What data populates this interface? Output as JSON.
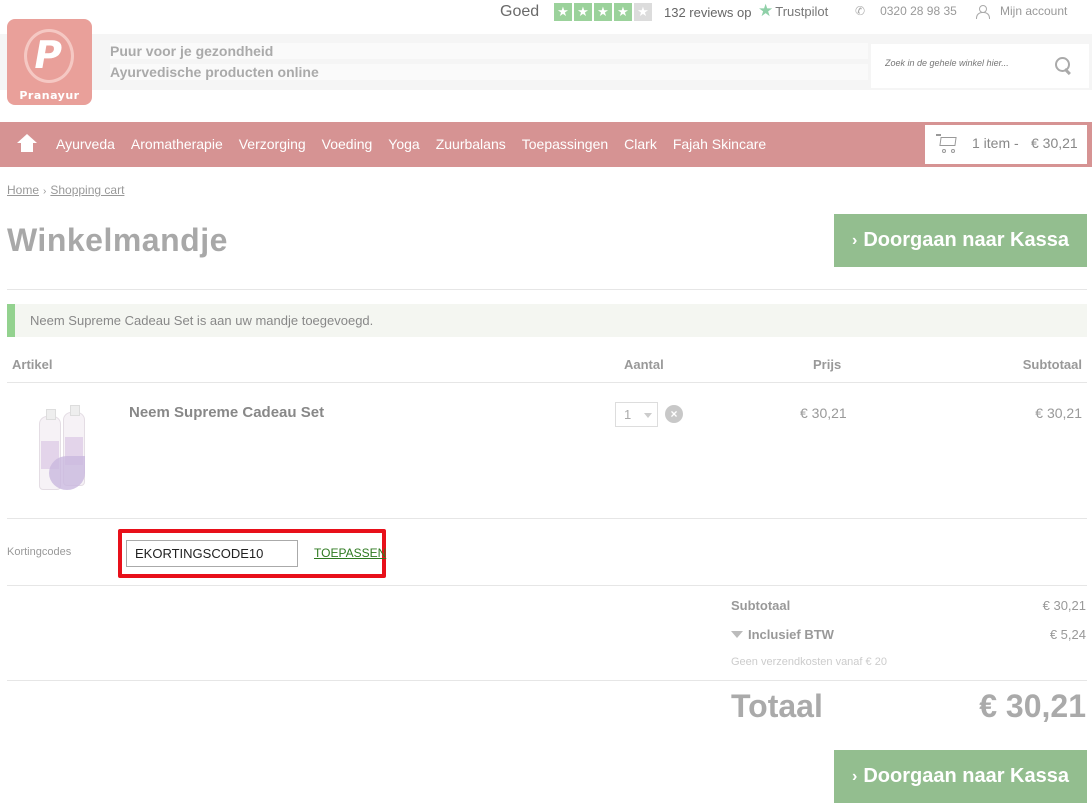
{
  "topbar": {
    "rating_word": "Goed",
    "stars_filled": 4,
    "stars_total": 5,
    "reviews_text": "132 reviews op",
    "trustpilot": "Trustpilot",
    "phone": "0320 28 98 35",
    "account": "Mijn account"
  },
  "header": {
    "logo_text": "Pranayur",
    "tagline_1": "Puur voor je gezondheid",
    "tagline_2": "Ayurvedische producten online",
    "search_placeholder": "Zoek in de gehele winkel hier..."
  },
  "nav": {
    "items": [
      "Ayurveda",
      "Aromatherapie",
      "Verzorging",
      "Voeding",
      "Yoga",
      "Zuurbalans",
      "Toepassingen",
      "Clark",
      "Fajah Skincare"
    ]
  },
  "cart": {
    "count_text": "1 item -",
    "total": "€ 30,21"
  },
  "breadcrumb": {
    "home": "Home",
    "separator": "›",
    "current": "Shopping cart"
  },
  "page": {
    "title": "Winkelmandje",
    "checkout_label": "Doorgaan naar Kassa",
    "notice": "Neem Supreme Cadeau Set is aan uw mandje toegevoegd."
  },
  "table": {
    "headers": {
      "article": "Artikel",
      "qty": "Aantal",
      "price": "Prijs",
      "subtotal": "Subtotaal"
    },
    "rows": [
      {
        "name": "Neem Supreme Cadeau Set",
        "qty": "1",
        "price": "€ 30,21",
        "subtotal": "€ 30,21"
      }
    ]
  },
  "coupon": {
    "label": "Kortingcodes",
    "value": "EKORTINGSCODE10",
    "apply": "TOEPASSEN"
  },
  "summary": {
    "subtotal_label": "Subtotaal",
    "subtotal_value": "€ 30,21",
    "tax_label": "Inclusief BTW",
    "tax_value": "€ 5,24",
    "shipping_note": "Geen verzendkosten vanaf € 20",
    "total_label": "Totaal",
    "total_value": "€ 30,21"
  },
  "colors": {
    "nav": "#d69393",
    "checkout": "#93be8f",
    "highlight": "#e8101a",
    "apply_link": "#2e7a20"
  }
}
